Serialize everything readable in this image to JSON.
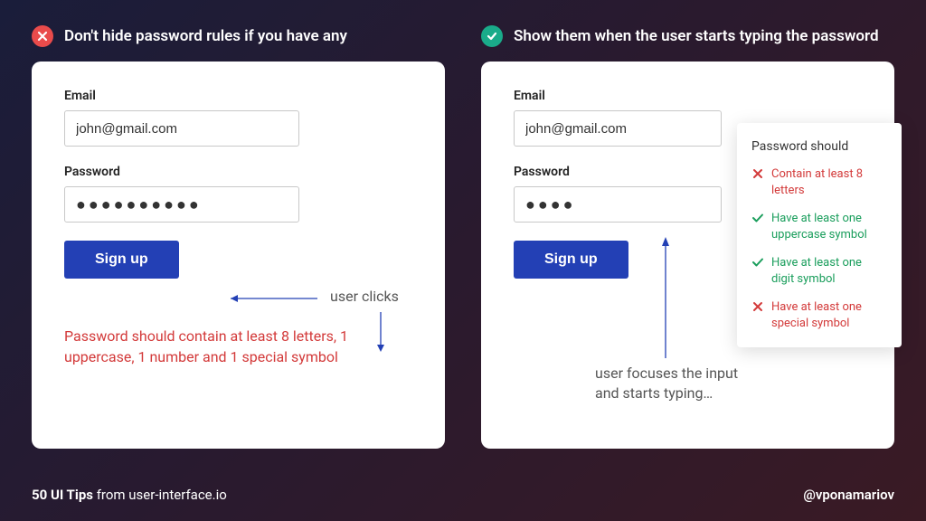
{
  "headers": {
    "bad": "Don't hide password rules if you have any",
    "good": "Show them when the user starts typing the password"
  },
  "left": {
    "email_label": "Email",
    "email_value": "john@gmail.com",
    "password_label": "Password",
    "password_value": "●●●●●●●●●●",
    "signup_label": "Sign up",
    "annotation": "user clicks",
    "error": "Password should contain at least 8 letters, 1 uppercase, 1 number and 1 special symbol"
  },
  "right": {
    "email_label": "Email",
    "email_value": "john@gmail.com",
    "password_label": "Password",
    "password_value": "●●●●",
    "signup_label": "Sign up",
    "annotation": "user focuses the input\nand starts typing…",
    "rules_title": "Password should",
    "rules": [
      {
        "status": "fail",
        "text": "Contain at least 8 letters"
      },
      {
        "status": "pass",
        "text": "Have at least one uppercase symbol"
      },
      {
        "status": "pass",
        "text": "Have at least one digit symbol"
      },
      {
        "status": "fail",
        "text": "Have at least one special symbol"
      }
    ]
  },
  "footer": {
    "bold": "50 UI Tips",
    "rest": " from user-interface.io",
    "handle": "@vponamariov"
  },
  "colors": {
    "bad": "#e94b4b",
    "good": "#1aab8a",
    "primary": "#2340b5",
    "error": "#d33a3a",
    "success": "#1a9e5c"
  }
}
